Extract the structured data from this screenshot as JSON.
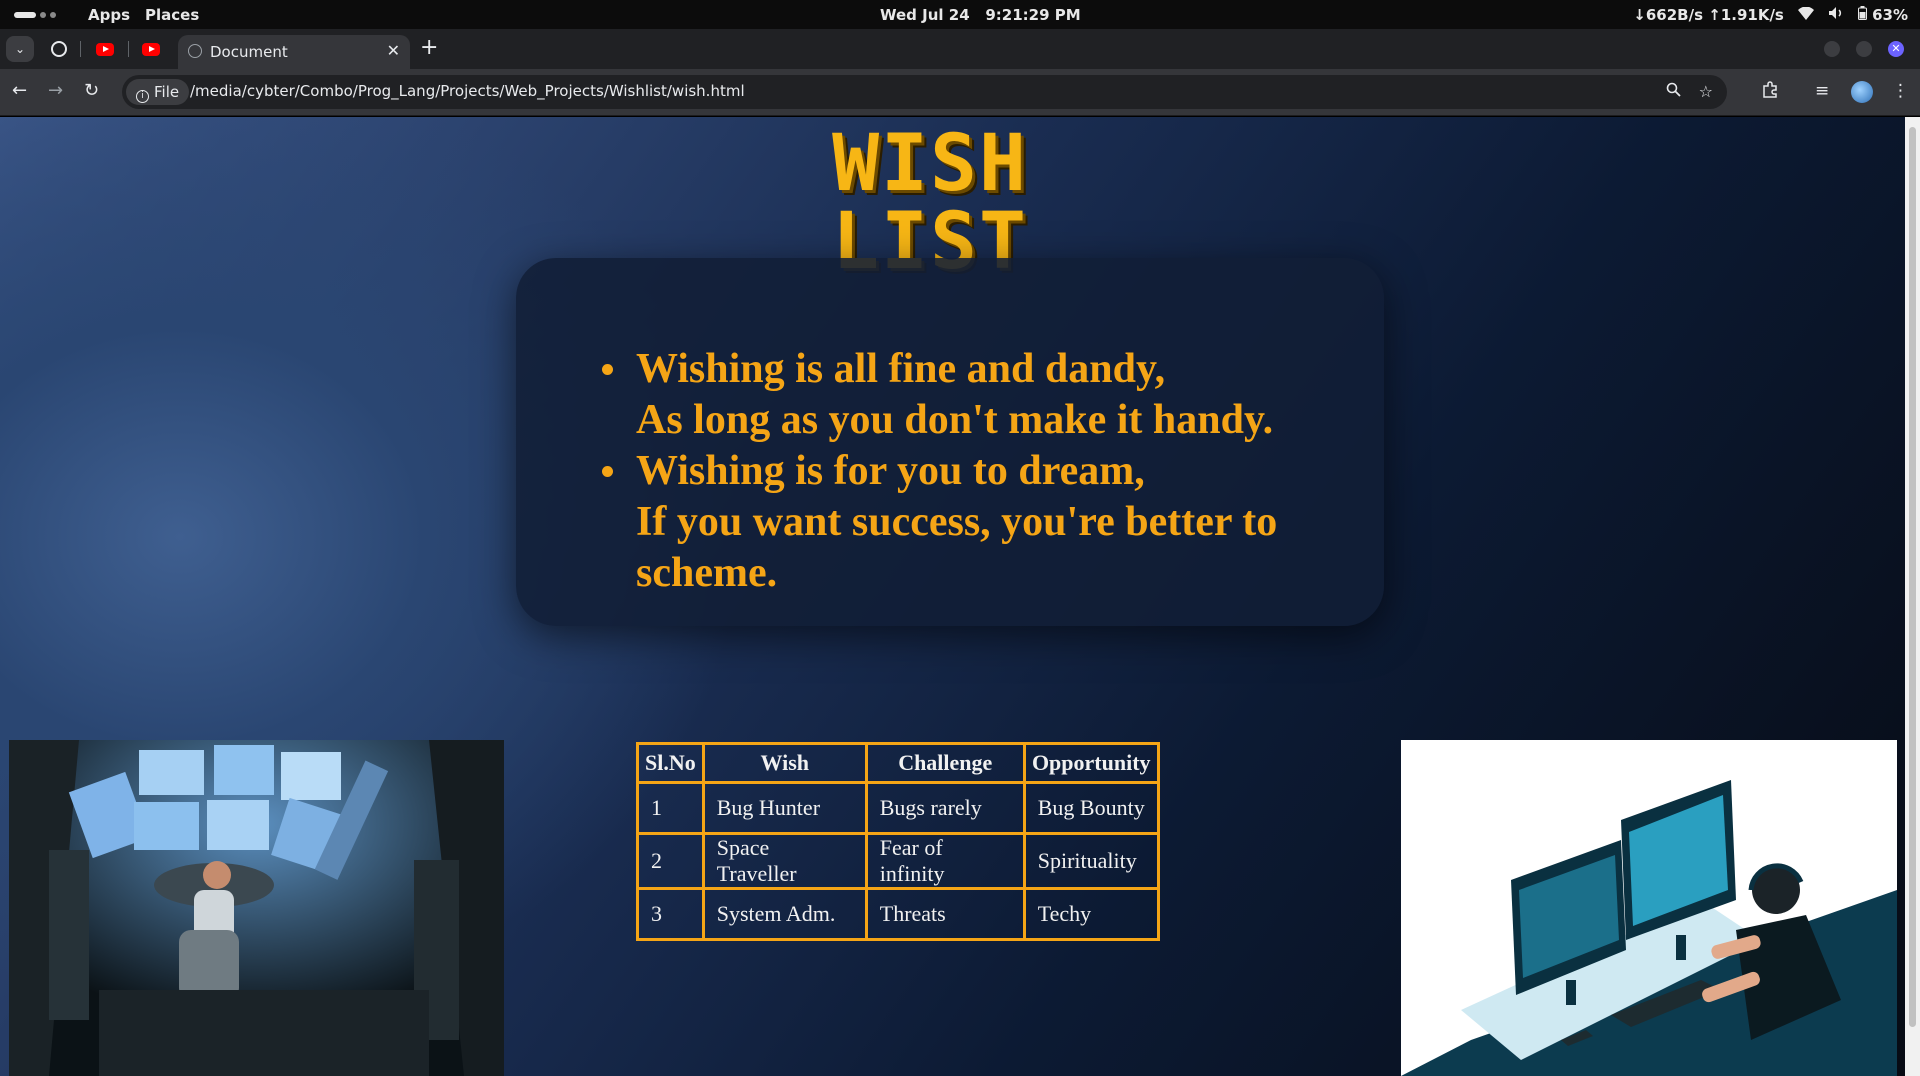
{
  "topbar": {
    "apps_label": "Apps",
    "places_label": "Places",
    "date": "Wed Jul 24",
    "time": "9:21:29 PM",
    "network_speed": "↓662B/s ↑1.91K/s",
    "battery": "63%"
  },
  "tabs": {
    "active_title": "Document"
  },
  "toolbar": {
    "scheme_label": "File",
    "url": "/media/cybter/Combo/Prog_Lang/Projects/Web_Projects/Wishlist/wish.html"
  },
  "page": {
    "heading": "WISH LIST",
    "poem": [
      {
        "line1": "Wishing is all fine and dandy,",
        "line2": "As long as you don't make it handy."
      },
      {
        "line1": "Wishing is for you to dream,",
        "line2": "If you want success, you're better to scheme."
      }
    ],
    "table": {
      "headers": [
        "Sl.No",
        "Wish",
        "Challenge",
        "Opportunity"
      ],
      "rows": [
        [
          "1",
          "Bug Hunter",
          "Bugs rarely",
          "Bug Bounty"
        ],
        [
          "2",
          "Space Traveller",
          "Fear of infinity",
          "Spirituality"
        ],
        [
          "3",
          "System Adm.",
          "Threats",
          "Techy"
        ]
      ]
    }
  },
  "colors": {
    "accent": "#f5a516",
    "heading": "#f7b615",
    "card": "#111e36"
  }
}
